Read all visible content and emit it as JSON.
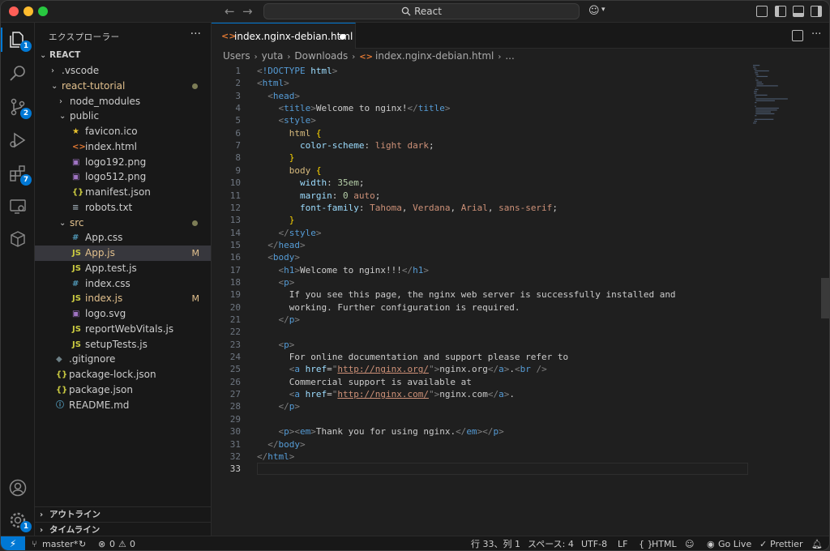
{
  "window": {
    "command_center": "React"
  },
  "activity_bar": {
    "explorer_badge": "1",
    "scm_badge": "2",
    "extensions_badge": "7",
    "accounts_badge": "1"
  },
  "sidebar": {
    "title": "エクスプローラー",
    "more": "···",
    "root": "REACT",
    "tree": [
      {
        "name": ".vscode",
        "type": "folder",
        "expanded": false
      },
      {
        "name": "react-tutorial",
        "type": "folder",
        "expanded": true,
        "modified_dot": true
      },
      {
        "name": "node_modules",
        "type": "folder",
        "expanded": false
      },
      {
        "name": "public",
        "type": "folder",
        "expanded": true
      },
      {
        "name": "favicon.ico",
        "type": "file",
        "icon": "★"
      },
      {
        "name": "index.html",
        "type": "file",
        "icon": "<>"
      },
      {
        "name": "logo192.png",
        "type": "file",
        "icon": "▣"
      },
      {
        "name": "logo512.png",
        "type": "file",
        "icon": "▣"
      },
      {
        "name": "manifest.json",
        "type": "file",
        "icon": "{}"
      },
      {
        "name": "robots.txt",
        "type": "file",
        "icon": "≡"
      },
      {
        "name": "src",
        "type": "folder",
        "expanded": true,
        "modified_dot": true
      },
      {
        "name": "App.css",
        "type": "file",
        "icon": "#"
      },
      {
        "name": "App.js",
        "type": "file",
        "icon": "JS",
        "status": "M",
        "selected": true
      },
      {
        "name": "App.test.js",
        "type": "file",
        "icon": "JS"
      },
      {
        "name": "index.css",
        "type": "file",
        "icon": "#"
      },
      {
        "name": "index.js",
        "type": "file",
        "icon": "JS",
        "status": "M"
      },
      {
        "name": "logo.svg",
        "type": "file",
        "icon": "▣"
      },
      {
        "name": "reportWebVitals.js",
        "type": "file",
        "icon": "JS"
      },
      {
        "name": "setupTests.js",
        "type": "file",
        "icon": "JS"
      },
      {
        "name": ".gitignore",
        "type": "file",
        "icon": "◆"
      },
      {
        "name": "package-lock.json",
        "type": "file",
        "icon": "{}"
      },
      {
        "name": "package.json",
        "type": "file",
        "icon": "{}"
      },
      {
        "name": "README.md",
        "type": "file",
        "icon": "ⓘ"
      }
    ],
    "outline": "アウトライン",
    "timeline": "タイムライン"
  },
  "editor": {
    "tab": {
      "label": "index.nginx-debian.html",
      "icon": "<>"
    },
    "breadcrumb": [
      "Users",
      "yuta",
      "Downloads",
      "index.nginx-debian.html",
      "..."
    ],
    "current_line": "33",
    "lines": [
      "<!DOCTYPE html>",
      "<html>",
      "  <head>",
      "    <title>Welcome to nginx!</title>",
      "    <style>",
      "      html {",
      "        color-scheme: light dark;",
      "      }",
      "      body {",
      "        width: 35em;",
      "        margin: 0 auto;",
      "        font-family: Tahoma, Verdana, Arial, sans-serif;",
      "      }",
      "    </style>",
      "  </head>",
      "  <body>",
      "    <h1>Welcome to nginx!!!</h1>",
      "    <p>",
      "      If you see this page, the nginx web server is successfully installed and",
      "      working. Further configuration is required.",
      "    </p>",
      "",
      "    <p>",
      "      For online documentation and support please refer to",
      "      <a href=\"http://nginx.org/\">nginx.org</a>.<br />",
      "      Commercial support is available at",
      "      <a href=\"http://nginx.com/\">nginx.com</a>.",
      "    </p>",
      "",
      "    <p><em>Thank you for using nginx.</em></p>",
      "  </body>",
      "</html>",
      ""
    ]
  },
  "statusbar": {
    "branch": "master*",
    "errors": "0",
    "warnings": "0",
    "position": "行 33、列 1",
    "spaces": "スペース: 4",
    "encoding": "UTF-8",
    "eol": "LF",
    "language": "HTML",
    "golive": "Go Live",
    "prettier": "Prettier"
  }
}
